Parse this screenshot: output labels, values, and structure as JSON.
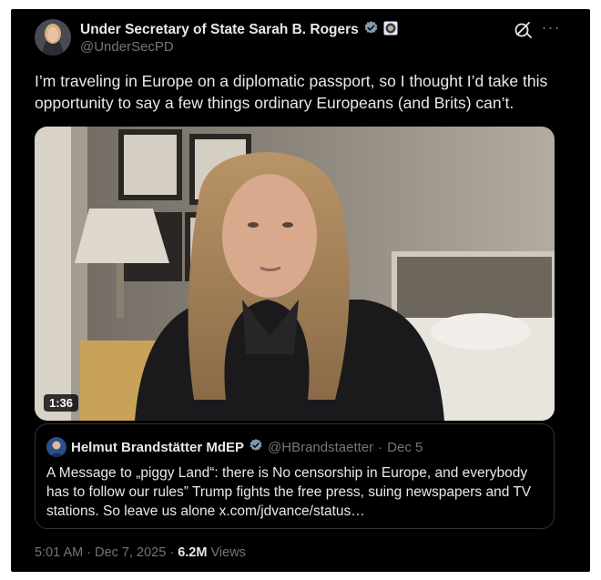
{
  "post": {
    "author_name": "Under Secretary of State Sarah B. Rogers",
    "author_handle": "@UnderSecPD",
    "text": "I’m traveling in Europe on a diplomatic passport, so I thought I’d take this opportunity to say a few things ordinary Europeans (and Brits) can’t.",
    "video_duration": "1:36",
    "time": "5:01 AM",
    "date": "Dec 7, 2025",
    "dot": "·",
    "views_count": "6.2M",
    "views_label": "Views"
  },
  "quoted": {
    "author_name": "Helmut Brandstätter MdEP",
    "author_handle": "@HBrandstaetter",
    "separator": "·",
    "date": "Dec 5",
    "text": "A Message to „piggy Land“: there is No censorship in Europe, and everybody has to follow our rules” Trump fights the free press, suing newspapers and TV stations. So leave us alone x.com/jdvance/status…"
  },
  "icons": {
    "verified": "verified-badge-icon",
    "affiliate": "government-seal-icon",
    "grok": "grok-icon",
    "more": "more-options-icon"
  },
  "colors": {
    "background": "#000000",
    "text_primary": "#e7e9ea",
    "text_secondary": "#71767b",
    "verified": "#829aab",
    "border": "#2f3336"
  }
}
